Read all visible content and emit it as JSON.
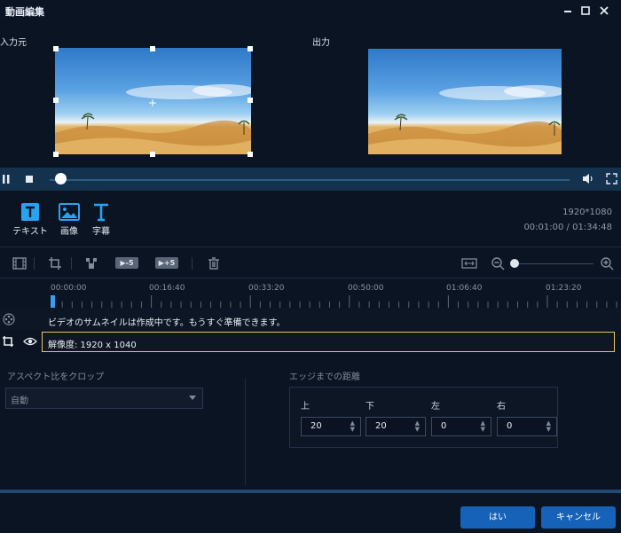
{
  "window": {
    "title": "動画編集"
  },
  "preview": {
    "input_label": "入力元",
    "output_label": "出力"
  },
  "tools": [
    {
      "icon": "text-icon",
      "label": "テキスト"
    },
    {
      "icon": "image-icon",
      "label": "画像"
    },
    {
      "icon": "subtitle-icon",
      "label": "字幕"
    }
  ],
  "info": {
    "resolution": "1920*1080",
    "time": "00:01:00 / 01:34:48"
  },
  "toolbar": {
    "skip_back_label": "▶-5",
    "skip_forward_label": "▶+5"
  },
  "ruler": {
    "labels": [
      "00:00:00",
      "00:16:40",
      "00:33:20",
      "00:50:00",
      "01:06:40",
      "01:23:20"
    ]
  },
  "timeline": {
    "thumbnail_notice": "ビデオのサムネイルは作成中です。もうすぐ準備できます。",
    "clip_label": "解像度: 1920 x 1040"
  },
  "crop": {
    "aspect_title": "アスペクト比をクロップ",
    "aspect_value": "自動"
  },
  "edge": {
    "title": "エッジまでの距離",
    "fields": [
      {
        "label": "上",
        "value": "20"
      },
      {
        "label": "下",
        "value": "20"
      },
      {
        "label": "左",
        "value": "0"
      },
      {
        "label": "右",
        "value": "0"
      }
    ]
  },
  "buttons": {
    "ok": "はい",
    "cancel": "キャンセル"
  },
  "colors": {
    "accent": "#1662b8",
    "playbar": "#14314d",
    "background": "#0b1423",
    "clip_border": "#e3c660"
  }
}
